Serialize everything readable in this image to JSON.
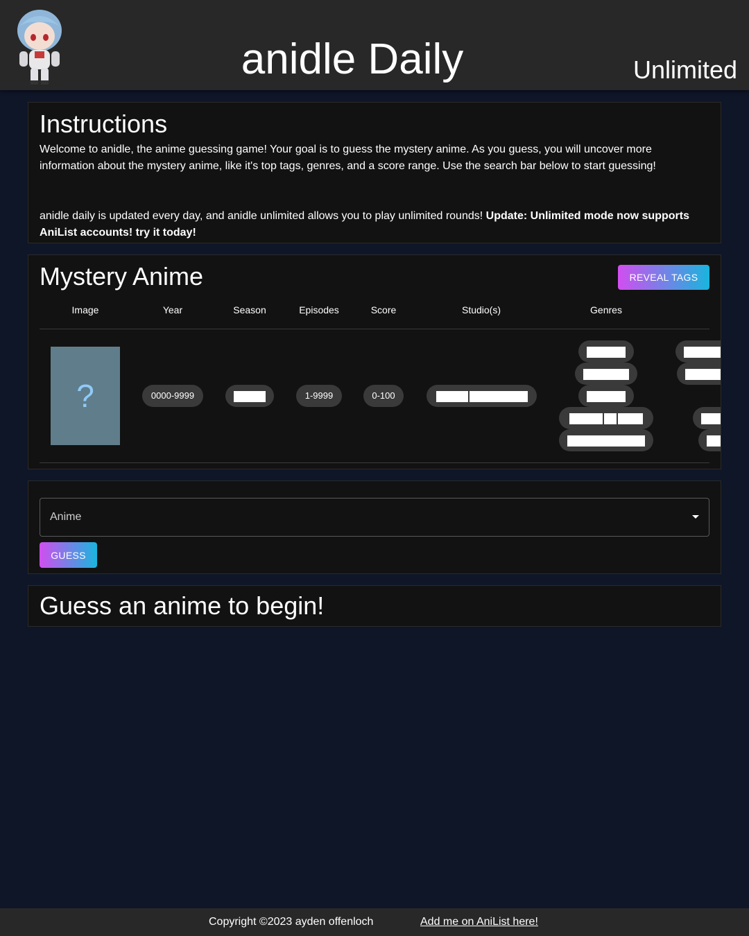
{
  "header": {
    "title": "anidle Daily",
    "unlimited_label": "Unlimited"
  },
  "instructions": {
    "title": "Instructions",
    "paragraph1": "Welcome to anidle, the anime guessing game! Your goal is to guess the mystery anime. As you guess, you will uncover more information about the mystery anime, like it's top tags, genres, and a score range. Use the search bar below to start guessing!",
    "paragraph2_prefix": "anidle daily is updated every day, and anidle unlimited allows you to play unlimited rounds! ",
    "paragraph2_bold": "Update: Unlimited mode now supports AniList accounts! try it today!"
  },
  "mystery": {
    "title": "Mystery Anime",
    "reveal_label": "REVEAL TAGS",
    "columns": [
      "Image",
      "Year",
      "Season",
      "Episodes",
      "Score",
      "Studio(s)",
      "Genres"
    ],
    "image_placeholder": "?",
    "year_range": "0000-9999",
    "episodes_range": "1-9999",
    "score_range": "0-100"
  },
  "guess": {
    "select_label": "Anime",
    "button_label": "GUESS"
  },
  "status": {
    "message": "Guess an anime to begin!"
  },
  "footer": {
    "copyright": "Copyright ©2023 ayden offenloch",
    "anilist_link": "Add me on AniList here!"
  },
  "colors": {
    "background": "#0e1628",
    "card": "#121212",
    "header": "#282828",
    "gradient_start": "#d24ef0",
    "gradient_end": "#19b5dd",
    "placeholder": "#607d8b"
  }
}
